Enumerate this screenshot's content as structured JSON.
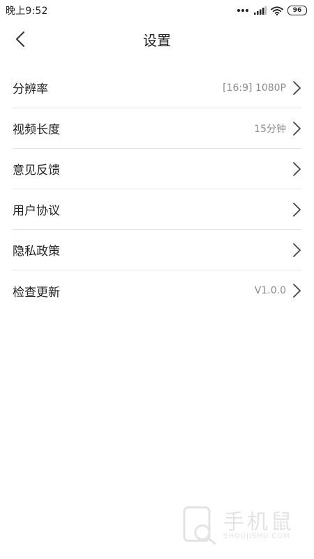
{
  "status_bar": {
    "time": "晚上9:52",
    "battery": "96"
  },
  "header": {
    "title": "设置"
  },
  "settings": {
    "items": [
      {
        "label": "分辨率",
        "value": "[16:9] 1080P"
      },
      {
        "label": "视频长度",
        "value": "15分钟"
      },
      {
        "label": "意见反馈",
        "value": ""
      },
      {
        "label": "用户协议",
        "value": ""
      },
      {
        "label": "隐私政策",
        "value": ""
      },
      {
        "label": "检查更新",
        "value": "V1.0.0"
      }
    ]
  },
  "watermark": {
    "title": "手机鼠",
    "subtitle": "SHOUJISHU.COM"
  },
  "colors": {
    "text": "#222222",
    "secondary_text": "#8c8c8c",
    "divider": "#e4e4e4",
    "background": "#ffffff"
  },
  "icons": {
    "back": "chevron-left-icon",
    "row_arrow": "chevron-right-icon",
    "wifi": "wifi-icon",
    "signal": "signal-icon",
    "battery": "battery-icon"
  }
}
